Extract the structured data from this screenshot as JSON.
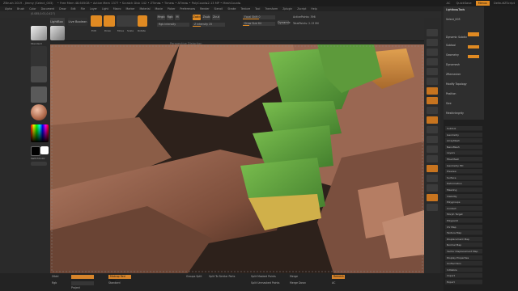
{
  "window": {
    "title": "ZBrush 2019 - Jimmy (Select_003)",
    "status": "• Free Mem 48.605GB • Active Mem 1377 • Scratch Disk 142 • ZTime▸ • Timer▸ • ATime▸ • PolyCount▸2.13 MP • MeshCount▸",
    "ac": "AC",
    "quicksave": "QuickSave",
    "menus_label": "Menus",
    "default_script": "DefaultZScript"
  },
  "menubar": [
    "Alpha",
    "Brush",
    "Color",
    "Document",
    "Draw",
    "Edit",
    "File",
    "Layer",
    "Light",
    "Macro",
    "Marker",
    "Material",
    "Movie",
    "Picker",
    "Preferences",
    "Render",
    "Stencil",
    "Stroke",
    "Texture",
    "Tool",
    "Transform",
    "Zplugin",
    "Zscript",
    "Help"
  ],
  "toolbar": {
    "home_page": "Home Page",
    "lightbox": "LightBox",
    "live_boolean": "Live Boolean",
    "edit": "Edit",
    "draw": "Draw",
    "move": "Move",
    "scale": "Scale",
    "rotate": "Rotate",
    "mrgb": "Mrgb",
    "rgb": "Rgb",
    "m": "M",
    "zadd": "Zadd",
    "zsub": "Zsub",
    "zcut": "Zcut",
    "rgb_intensity": "Rgb Intensity",
    "z_intensity": "Z Intensity 25",
    "focal_shift": "Focal Shift 0",
    "draw_size": "Draw Size 64",
    "dynamic": "Dynamic",
    "active_points": "ActivePoints: 396",
    "total_points": "TotalPoints: 2.13 Mil"
  },
  "coords": "(0.085,0.01,0.427)",
  "left_shelf": {
    "brush": "Standard",
    "stroke": "Dots",
    "alpha": "Off",
    "texture": "Texture Off",
    "material": "MatCap Red Wax",
    "gradient": "Gradient",
    "switch_color": "SwitchColor",
    "alternate": "Alternate"
  },
  "viewport_label": "Perspective Distortion",
  "tray": {
    "sections": [
      "Subtool",
      "Geometry",
      "ArrayMesh",
      "NanoMesh",
      "Layers",
      "FiberMesh",
      "Geometry HD",
      "Preview",
      "Surface",
      "Deformation",
      "Masking",
      "Visibility",
      "Polygroups",
      "Contact",
      "Morph Target",
      "Polypaint",
      "UV Map",
      "Texture Map",
      "Displacement Map",
      "Normal Map",
      "Vector Displacement Map",
      "Display Properties",
      "Unified Skin",
      "Initialize",
      "Import",
      "Export"
    ],
    "top_items": [
      "Subtool",
      "Geometry",
      "Dynamesh",
      "ZRemesher",
      "Modify Topology",
      "Position",
      "Size",
      "MeshIntegrity"
    ],
    "header_items": [
      "Lightbox▸Tools",
      "Select_003",
      "Dynamic Subdiv"
    ]
  },
  "bottombar": {
    "zbrush_label": "ZAdd",
    "rgb_label": "Rgb",
    "zsub_label": "Zsub",
    "material": "Matcap Red Wax",
    "brush_label": "Standard",
    "groups_split": "Groups Split",
    "split_to_similar": "Split To Similar Parts",
    "split_masked": "Split Masked Points",
    "split_unmasked": "Split Unmasked Points",
    "merge": "Merge",
    "merge_down": "Merge Down",
    "merge_visible": "Merge Visible",
    "remesh": "Remesh",
    "project": "Project",
    "auto_groups": "AutoGroups",
    "ac": "AC"
  },
  "colors": {
    "accent": "#e08a22",
    "skin": "#8a5a45",
    "armor_green": "#5fa040",
    "armor_orange": "#c88a3c"
  }
}
